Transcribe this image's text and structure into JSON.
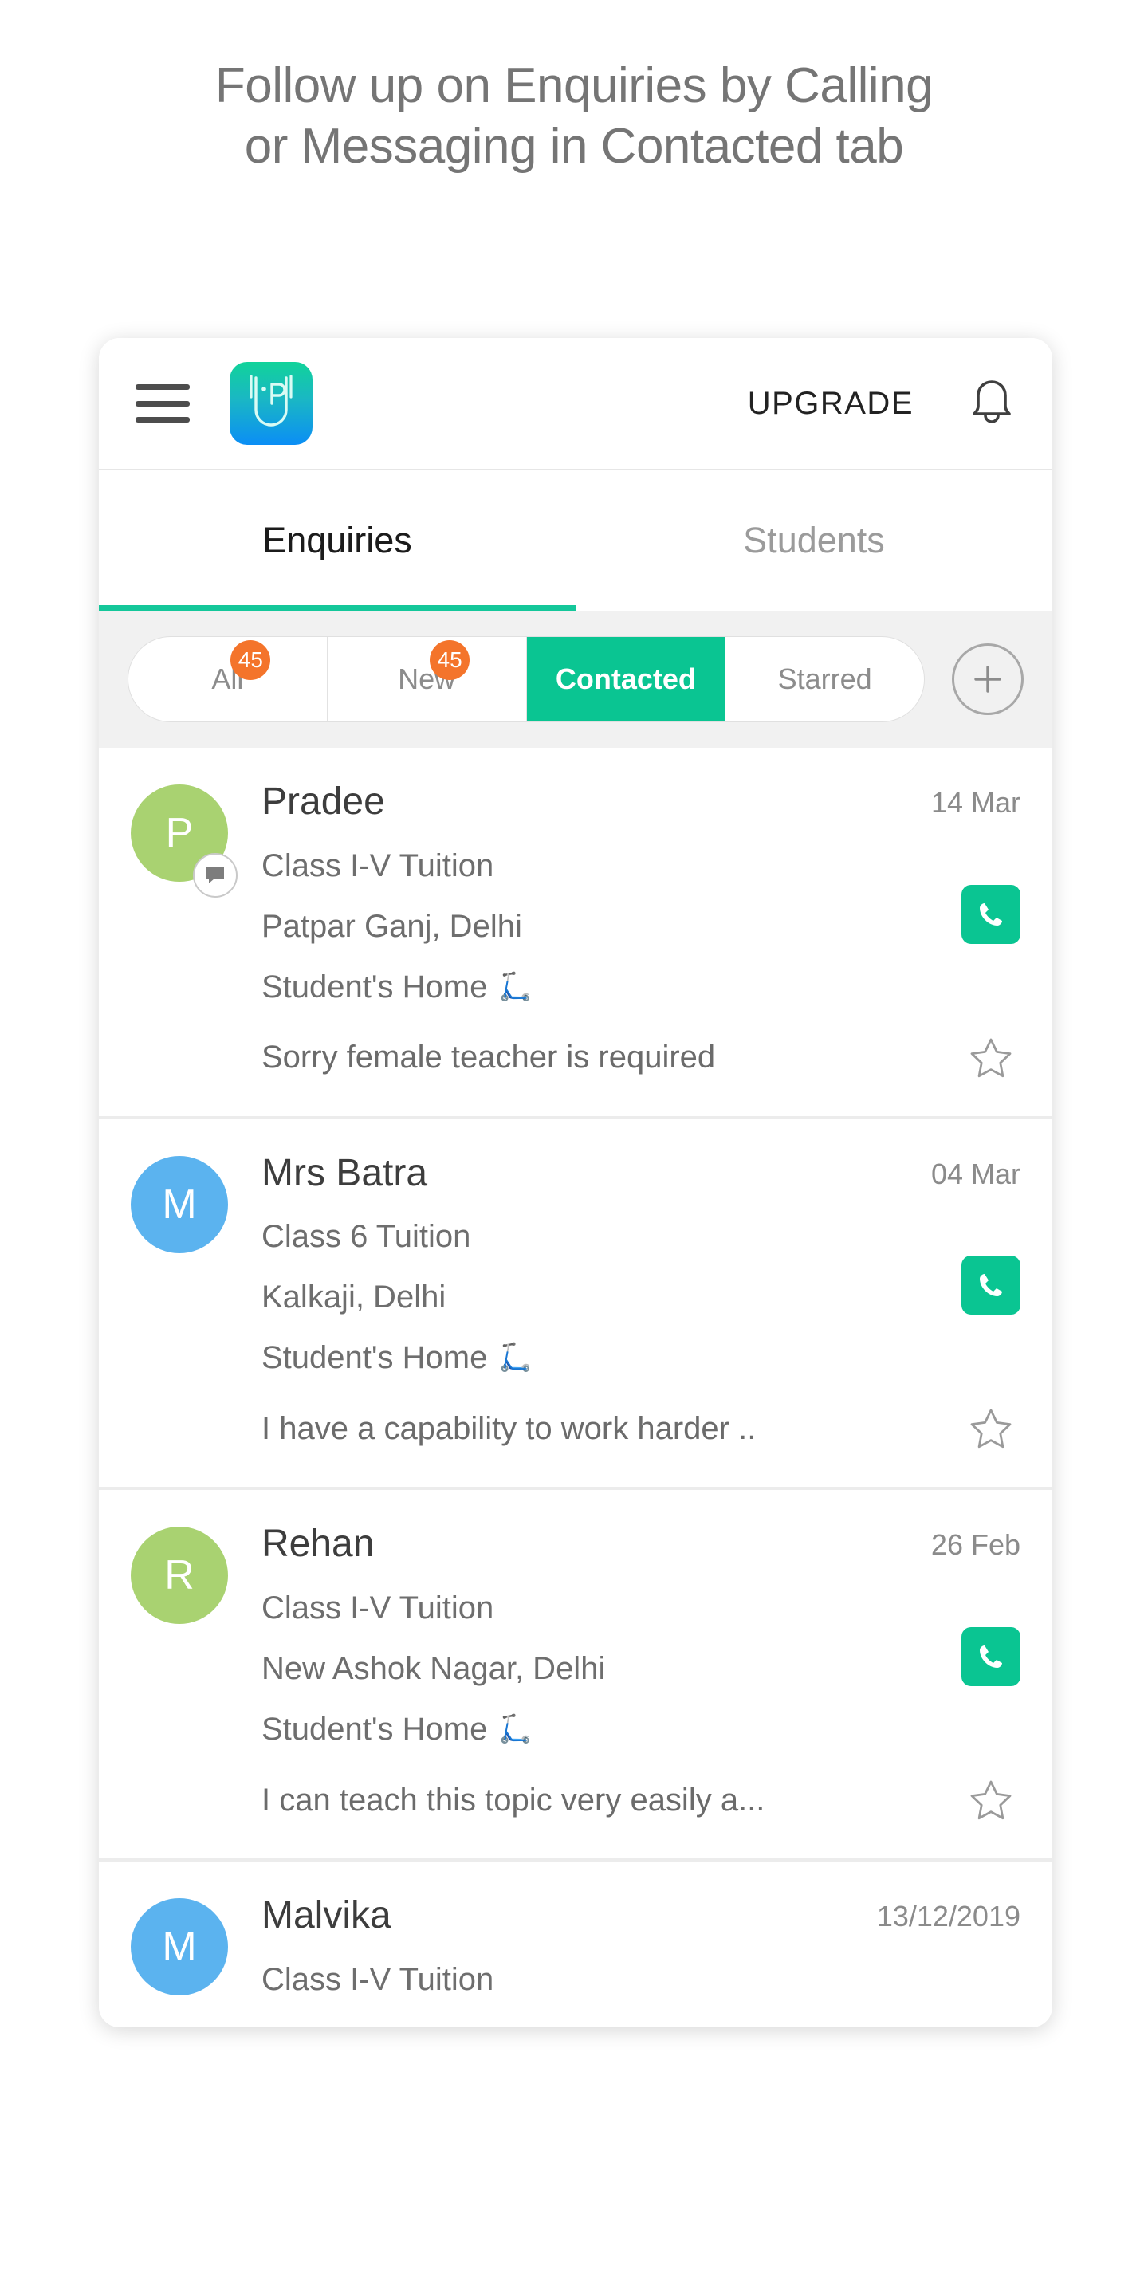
{
  "promo": {
    "line1": "Follow up on Enquiries by Calling",
    "line2": "or Messaging in Contacted tab"
  },
  "colors": {
    "accent_teal": "#0ac592",
    "badge_orange": "#f4742b",
    "avatar_green": "#a9d271",
    "avatar_blue": "#5bb3ef",
    "tab_underline": "#14c79a"
  },
  "app_bar": {
    "menu_icon": "hamburger-icon",
    "logo_letter": "P",
    "upgrade_label": "UPGRADE",
    "bell_icon": "bell-icon"
  },
  "main_tabs": [
    {
      "label": "Enquiries",
      "active": true
    },
    {
      "label": "Students",
      "active": false
    }
  ],
  "filters": [
    {
      "label": "All",
      "badge": "45",
      "active": false
    },
    {
      "label": "New",
      "badge": "45",
      "active": false
    },
    {
      "label": "Contacted",
      "badge": "",
      "active": true
    },
    {
      "label": "Starred",
      "badge": "",
      "active": false
    }
  ],
  "add_button": {
    "icon": "plus-circle-icon"
  },
  "enquiries": [
    {
      "name": "Pradee",
      "initial": "P",
      "avatar_color": "#a9d271",
      "has_chat_badge": true,
      "date": "14 Mar",
      "course": "Class I-V Tuition",
      "location": "Patpar Ganj, Delhi",
      "mode": "Student's Home",
      "mode_icon": "scooter-icon",
      "message": "Sorry female teacher is required",
      "call_icon": "phone-icon",
      "star_icon": "star-outline-icon"
    },
    {
      "name": "Mrs Batra",
      "initial": "M",
      "avatar_color": "#5bb3ef",
      "has_chat_badge": false,
      "date": "04 Mar",
      "course": "Class 6 Tuition",
      "location": "Kalkaji, Delhi",
      "mode": "Student's Home",
      "mode_icon": "scooter-icon",
      "message": "I have a capability to work harder ..",
      "call_icon": "phone-icon",
      "star_icon": "star-outline-icon"
    },
    {
      "name": "Rehan",
      "initial": "R",
      "avatar_color": "#a9d271",
      "has_chat_badge": false,
      "date": "26 Feb",
      "course": "Class I-V Tuition",
      "location": "New Ashok Nagar, Delhi",
      "mode": "Student's Home",
      "mode_icon": "scooter-icon",
      "message": "I can teach this topic very easily a...",
      "call_icon": "phone-icon",
      "star_icon": "star-outline-icon"
    },
    {
      "name": "Malvika",
      "initial": "M",
      "avatar_color": "#5bb3ef",
      "has_chat_badge": false,
      "date": "13/12/2019",
      "course": "Class I-V Tuition",
      "location": "",
      "mode": "",
      "mode_icon": "",
      "message": "",
      "call_icon": "",
      "star_icon": ""
    }
  ]
}
